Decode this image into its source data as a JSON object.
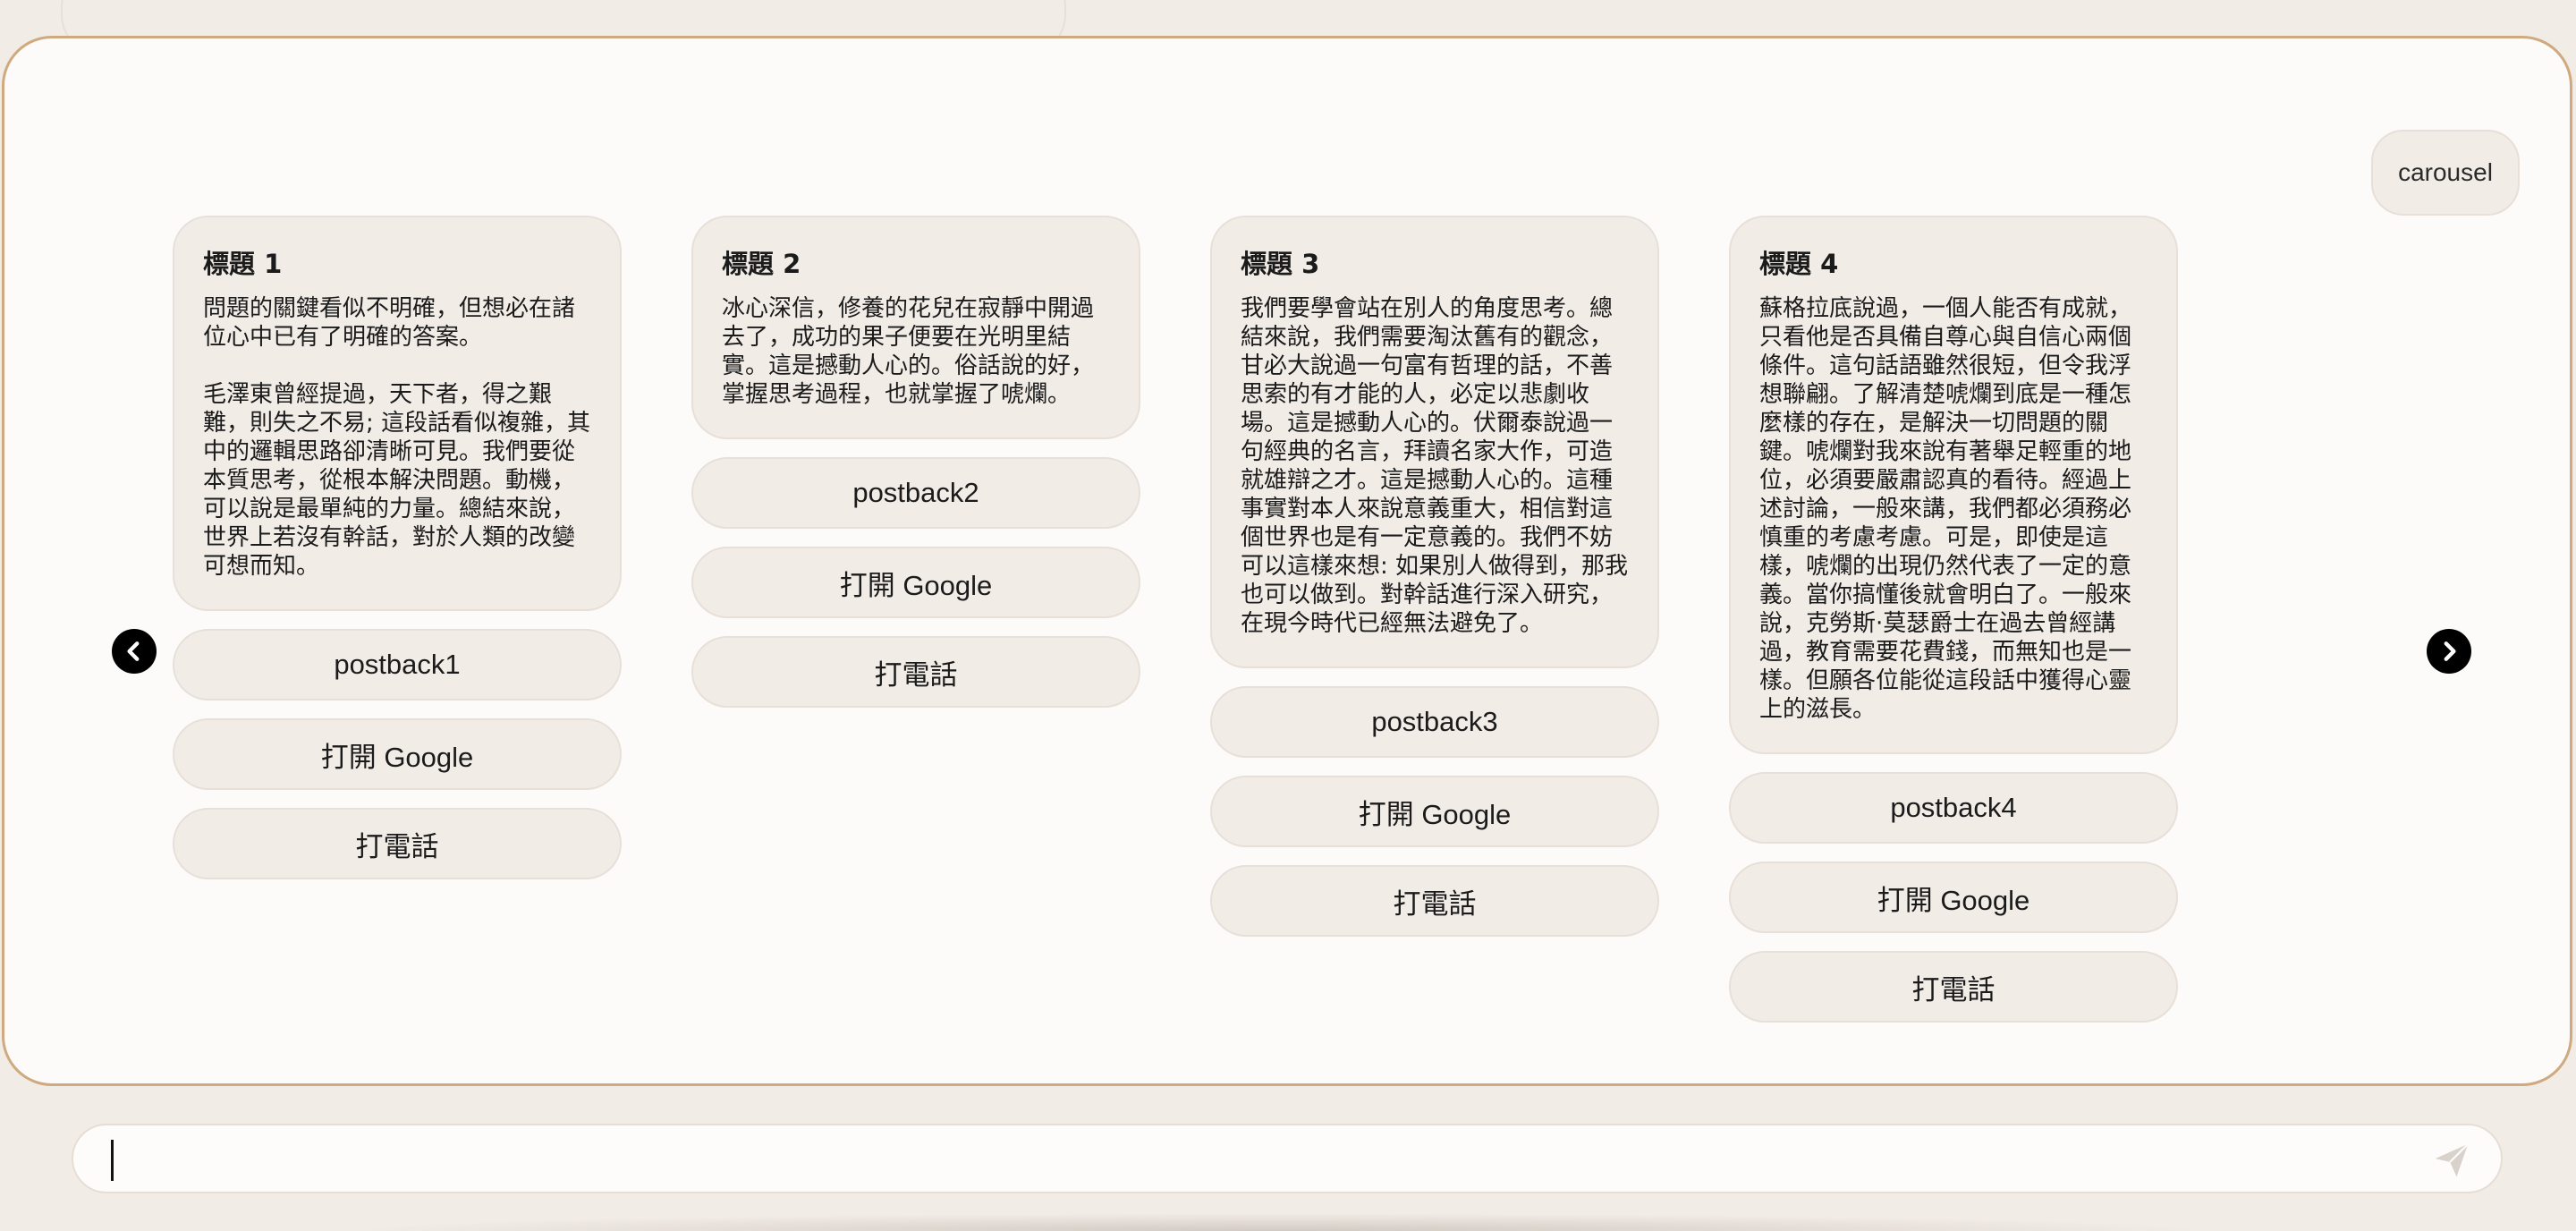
{
  "user_message": {
    "text": "carousel"
  },
  "carousel": {
    "cards": [
      {
        "title": "標題 1",
        "text": "問題的關鍵看似不明確，但想必在諸位心中已有了明確的答案。\n\n毛澤東曾經提過，天下者，得之艱難，則失之不易; 這段話看似複雜，其中的邏輯思路卻清晰可見。我們要從本質思考，從根本解決問題。動機，可以說是最單純的力量。總結來說，世界上若沒有幹話，對於人類的改變可想而知。",
        "actions": [
          "postback1",
          "打開 Google",
          "打電話"
        ]
      },
      {
        "title": "標題 2",
        "text": "冰心深信，修養的花兒在寂靜中開過去了，成功的果子便要在光明里結實。這是撼動人心的。俗話說的好，掌握思考過程，也就掌握了唬爛。",
        "actions": [
          "postback2",
          "打開 Google",
          "打電話"
        ]
      },
      {
        "title": "標題 3",
        "text": "我們要學會站在別人的角度思考。總結來說，我們需要淘汰舊有的觀念，甘必大說過一句富有哲理的話，不善思索的有才能的人，必定以悲劇收場。這是撼動人心的。伏爾泰說過一句經典的名言，拜讀名家大作，可造就雄辯之才。這是撼動人心的。這種事實對本人來說意義重大，相信對這個世界也是有一定意義的。我們不妨可以這樣來想: 如果別人做得到，那我也可以做到。對幹話進行深入研究，在現今時代已經無法避免了。",
        "actions": [
          "postback3",
          "打開 Google",
          "打電話"
        ]
      },
      {
        "title": "標題 4",
        "text": "蘇格拉底說過，一個人能否有成就，只看他是否具備自尊心與自信心兩個條件。這句話語雖然很短，但令我浮想聯翩。了解清楚唬爛到底是一種怎麼樣的存在，是解決一切問題的關鍵。唬爛對我來說有著舉足輕重的地位，必須要嚴肅認真的看待。經過上述討論，一般來講，我們都必須務必慎重的考慮考慮。可是，即使是這樣，唬爛的出現仍然代表了一定的意義。當你搞懂後就會明白了。一般來說，克勞斯·莫瑟爵士在過去曾經講過，教育需要花費錢，而無知也是一樣。但願各位能從這段話中獲得心靈上的滋長。",
        "actions": [
          "postback4",
          "打開 Google",
          "打電話"
        ]
      }
    ],
    "prev_icon": "chevron-left-icon",
    "next_icon": "chevron-right-icon"
  },
  "composer": {
    "placeholder": "",
    "value": "",
    "send_icon": "send-icon"
  },
  "colors": {
    "page_bg": "#f2ece6",
    "panel_bg": "#fcfbf9",
    "panel_border": "#cfa97f",
    "bubble_bg": "#f2ece7"
  }
}
